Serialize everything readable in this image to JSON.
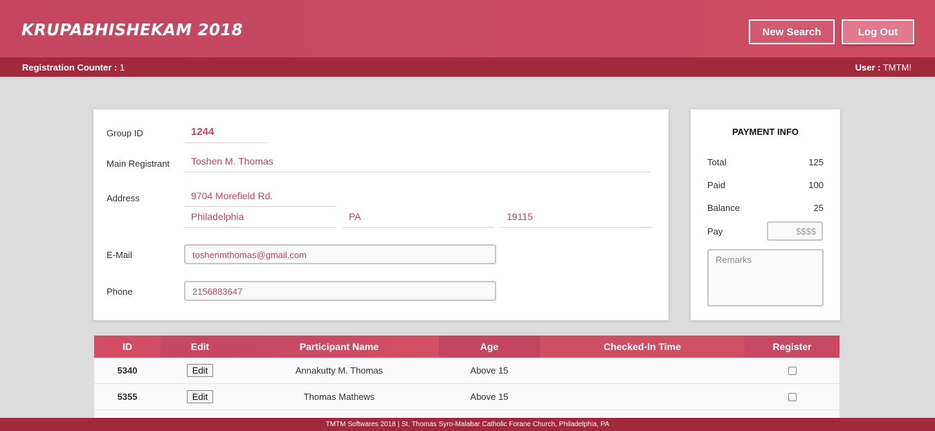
{
  "header": {
    "title": "KRUPABHISHEKAM 2018",
    "new_search_label": "New Search",
    "logout_label": "Log Out"
  },
  "subheader": {
    "counter_label": "Registration Counter :",
    "counter_value": "1",
    "user_label": "User :",
    "user_value": "TMTM!"
  },
  "registrant": {
    "group_id_label": "Group ID",
    "group_id": "1244",
    "main_registrant_label": "Main Registrant",
    "main_registrant": "Toshen M. Thomas",
    "address_label": "Address",
    "street": "9704 Morefield Rd.",
    "city": "Philadelphia",
    "state": "PA",
    "zip": "19115",
    "email_label": "E-Mail",
    "email": "toshenmthomas@gmail.com",
    "phone_label": "Phone",
    "phone": "2156883647"
  },
  "payment": {
    "title": "PAYMENT INFO",
    "total_label": "Total",
    "total": "125",
    "paid_label": "Paid",
    "paid": "100",
    "balance_label": "Balance",
    "balance": "25",
    "pay_label": "Pay",
    "pay_placeholder": "$$$$",
    "remarks_placeholder": "Remarks"
  },
  "table": {
    "columns": [
      "ID",
      "Edit",
      "Participant Name",
      "Age",
      "Checked-In Time",
      "Register"
    ],
    "edit_label": "Edit",
    "rows": [
      {
        "id": "5340",
        "name": "Annakutty M. Thomas",
        "age": "Above 15",
        "checked_in": ""
      },
      {
        "id": "5355",
        "name": "Thomas Mathews",
        "age": "Above 15",
        "checked_in": ""
      }
    ]
  },
  "footer": {
    "text": "TMTM Softwares 2018 | St. Thomas Syro-Malabar Catholic Forane Church, Philadelphia, PA"
  },
  "colors": {
    "brand": "#c4475f",
    "brand_dark": "#a02a3c",
    "value_text": "#c44862"
  }
}
